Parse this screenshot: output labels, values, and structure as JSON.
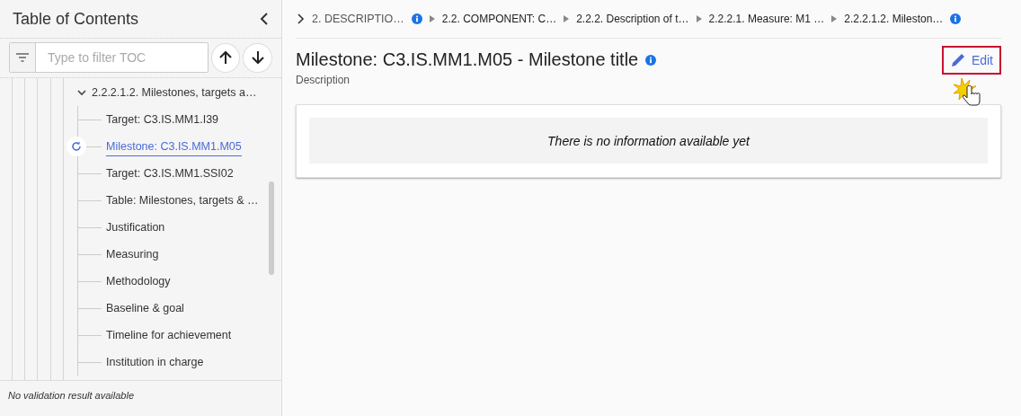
{
  "sidebar": {
    "title": "Table of Contents",
    "filter": {
      "placeholder": "Type to filter TOC"
    },
    "tree": [
      {
        "label": "2.2.2.1.2. Milestones, targets a…",
        "expanded": true,
        "children": [
          {
            "label": "Target: C3.IS.MM1.I39",
            "selected": false
          },
          {
            "label": "Milestone: C3.IS.MM1.M05",
            "selected": true
          },
          {
            "label": "Target: C3.IS.MM1.SSI02",
            "selected": false
          },
          {
            "label": "Table: Milestones, targets & …",
            "selected": false
          },
          {
            "label": "Justification",
            "selected": false
          },
          {
            "label": "Measuring",
            "selected": false
          },
          {
            "label": "Methodology",
            "selected": false
          },
          {
            "label": "Baseline & goal",
            "selected": false
          },
          {
            "label": "Timeline for achievement",
            "selected": false
          },
          {
            "label": "Institution in charge",
            "selected": false
          }
        ]
      }
    ],
    "footer": "No validation result available"
  },
  "breadcrumbs": [
    {
      "label": "2. DESCRIPTIO…",
      "info": true
    },
    {
      "label": "2.2. COMPONENT: C…",
      "info": false
    },
    {
      "label": "2.2.2. Description of t…",
      "info": false
    },
    {
      "label": "2.2.2.1. Measure: M1 …",
      "info": false
    },
    {
      "label": "2.2.2.1.2. Mileston…",
      "info": true
    }
  ],
  "header": {
    "title": "Milestone: C3.IS.MM1.M05 - Milestone title",
    "subtitle": "Description",
    "edit_button": "Edit"
  },
  "content": {
    "message": "There is no information available yet"
  }
}
